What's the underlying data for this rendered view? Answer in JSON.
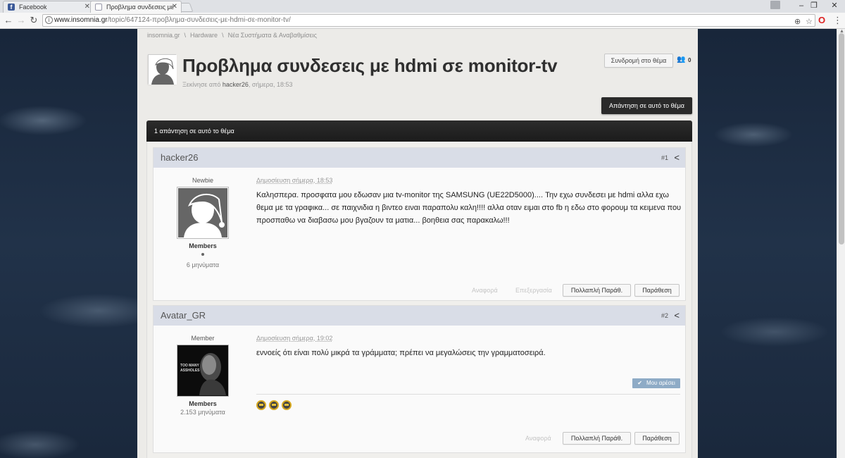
{
  "browser": {
    "tabs": [
      {
        "title": "Facebook",
        "active": false
      },
      {
        "title": "Προβλημα συνδεσεις με",
        "active": true
      }
    ],
    "url_host": "www.insomnia.gr",
    "url_path": "/topic/647124-προβλημα-συνδεσεις-με-hdmi-σε-monitor-tv/"
  },
  "breadcrumb": [
    "insomnia.gr",
    "Hardware",
    "Νέα Συστήματα & Αναβαθμίσεις"
  ],
  "topic": {
    "title": "Προβλημα συνδεσεις με hdmi σε monitor-tv",
    "started_prefix": "Ξεκίνησε από",
    "author": "hacker26",
    "started_time": ", σήμερα, 18:53",
    "follow_label": "Συνδρομή στο θέμα",
    "followers_count": "0",
    "reply_label": "Απάντηση σε αυτό το θέμα",
    "replies_summary": "1 απάντηση σε αυτό το θέμα"
  },
  "posts": [
    {
      "author": "hacker26",
      "number": "#1",
      "rank": "Newbie",
      "group": "Members",
      "post_count": "6 μηνύματα",
      "date": "Δημοσίευση σήμερα, 18:53",
      "body": "Καλησπερα. προσφατα μου εδωσαν μια tv-monitor της SAMSUNG (UE22D5000).... Την εχω συνδεσει με hdmi αλλα εχω θεμα με τα γραφικα... σε παιχνιδια η βιντεο ειναι παραπολυ καλη!!!! αλλα οταν ειμαι στο fb η εδω στο φορουμ τα κειμενα που προσπαθω να διαβασω μου βγαζουν τα ματια... βοηθεια σας παρακαλω!!!",
      "report_label": "Αναφορά",
      "edit_label": "Επεξεργασία",
      "multiquote_label": "Πολλαπλή Παράθ.",
      "quote_label": "Παράθεση"
    },
    {
      "author": "Avatar_GR",
      "number": "#2",
      "rank": "Member",
      "group": "Members",
      "post_count": "2.153 μηνύματα",
      "date": "Δημοσίευση σήμερα, 19:02",
      "body": "εννοείς ότι είναι πολύ μικρά τα γράμματα; πρέπει να μεγαλώσεις την γραμματοσειρά.",
      "like_label": "Μου αρέσει",
      "avatar_text": "TOO MANY ASSHOLES",
      "report_label": "Αναφορά",
      "multiquote_label": "Πολλαπλή Παράθ.",
      "quote_label": "Παράθεση"
    }
  ],
  "colors": {
    "post_header_bg": "#d9dde7",
    "dark_bar": "#1b1b1b",
    "like_button": "#8eabc6"
  }
}
